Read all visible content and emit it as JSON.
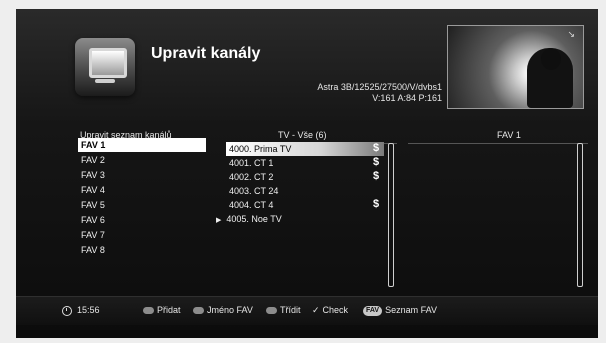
{
  "header": {
    "title": "Upravit kanály",
    "satellite": "Astra 3B/12525/27500/V/dvbs1",
    "signal": "V:161  A:84  P:161"
  },
  "columns": {
    "left": "Upravit seznam kanálů",
    "middle": "TV - Vše (6)",
    "right": "FAV 1"
  },
  "fav_lists": [
    "FAV 1",
    "FAV 2",
    "FAV 3",
    "FAV 4",
    "FAV 5",
    "FAV 6",
    "FAV 7",
    "FAV 8"
  ],
  "channels": [
    {
      "label": "4000. Prima TV",
      "marker": "$"
    },
    {
      "label": "4001. CT 1",
      "marker": "$"
    },
    {
      "label": "4002. CT 2",
      "marker": "$"
    },
    {
      "label": "4003. CT 24",
      "marker": ""
    },
    {
      "label": "4004. CT 4",
      "marker": "$"
    },
    {
      "label": "4005. Noe TV",
      "marker": ""
    }
  ],
  "footer": {
    "time": "15:56",
    "add": "Přidat",
    "rename": "Jméno FAV",
    "sort": "Třídit",
    "check": "Check",
    "fav_badge": "FAV",
    "fav_list": "Seznam FAV"
  },
  "icons": {
    "clock": "clock-icon",
    "play": "play-icon",
    "check": "check-icon"
  },
  "colors": {
    "background": "#0c0c0c",
    "selection": "#ffffff",
    "footer_pill": "#8c8c8c"
  }
}
